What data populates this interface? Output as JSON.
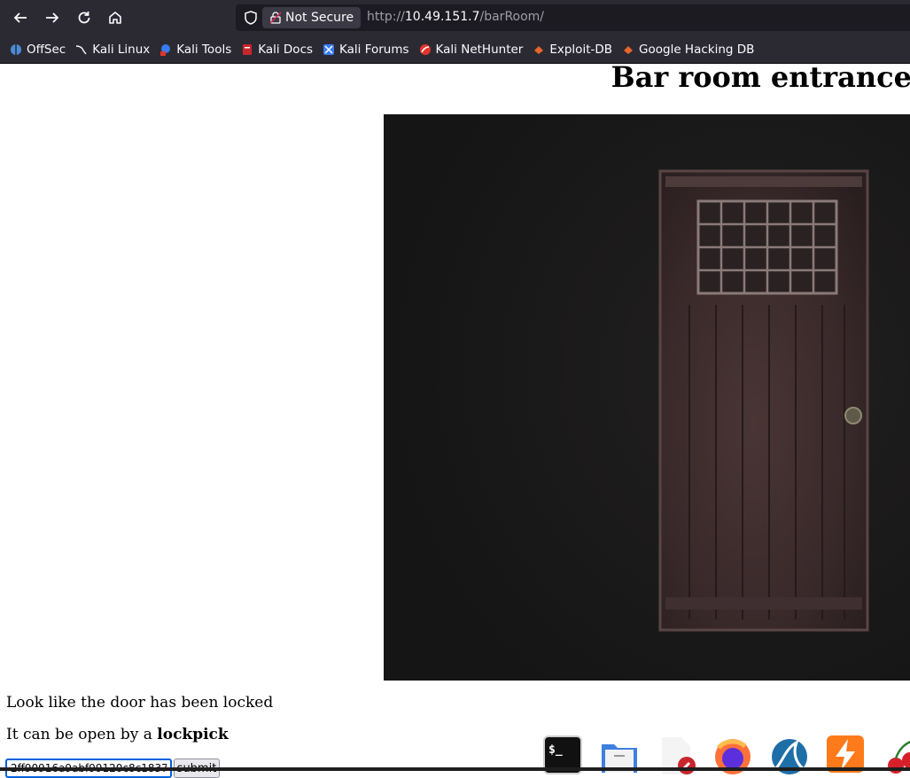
{
  "browser": {
    "security_label": "Not Secure",
    "url_scheme": "http://",
    "url_host": "10.49.151.7",
    "url_path": "/barRoom/"
  },
  "bookmarks": [
    {
      "label": "OffSec",
      "icon": "offsec-icon"
    },
    {
      "label": "Kali Linux",
      "icon": "kali-dragon-icon"
    },
    {
      "label": "Kali Tools",
      "icon": "kali-tools-icon"
    },
    {
      "label": "Kali Docs",
      "icon": "kali-docs-icon"
    },
    {
      "label": "Kali Forums",
      "icon": "kali-forums-icon"
    },
    {
      "label": "Kali NetHunter",
      "icon": "nethunter-icon"
    },
    {
      "label": "Exploit-DB",
      "icon": "exploit-db-icon"
    },
    {
      "label": "Google Hacking DB",
      "icon": "ghdb-icon"
    }
  ],
  "page": {
    "title": "Bar room entrance",
    "message": "Look like the door has been locked",
    "hint_prefix": "It can be open by a ",
    "hint_bold": "lockpick",
    "input_value": "2ff90916a9abf99120c8c1837",
    "submit_label": "submit"
  },
  "dock": [
    "terminal-icon",
    "files-icon",
    "text-editor-icon",
    "firefox-icon",
    "wireshark-icon",
    "burpsuite-icon",
    "cherrytree-icon"
  ],
  "colors": {
    "chrome": "#2b2a33",
    "urlbar": "#1c1b22",
    "focus": "#0060df"
  }
}
